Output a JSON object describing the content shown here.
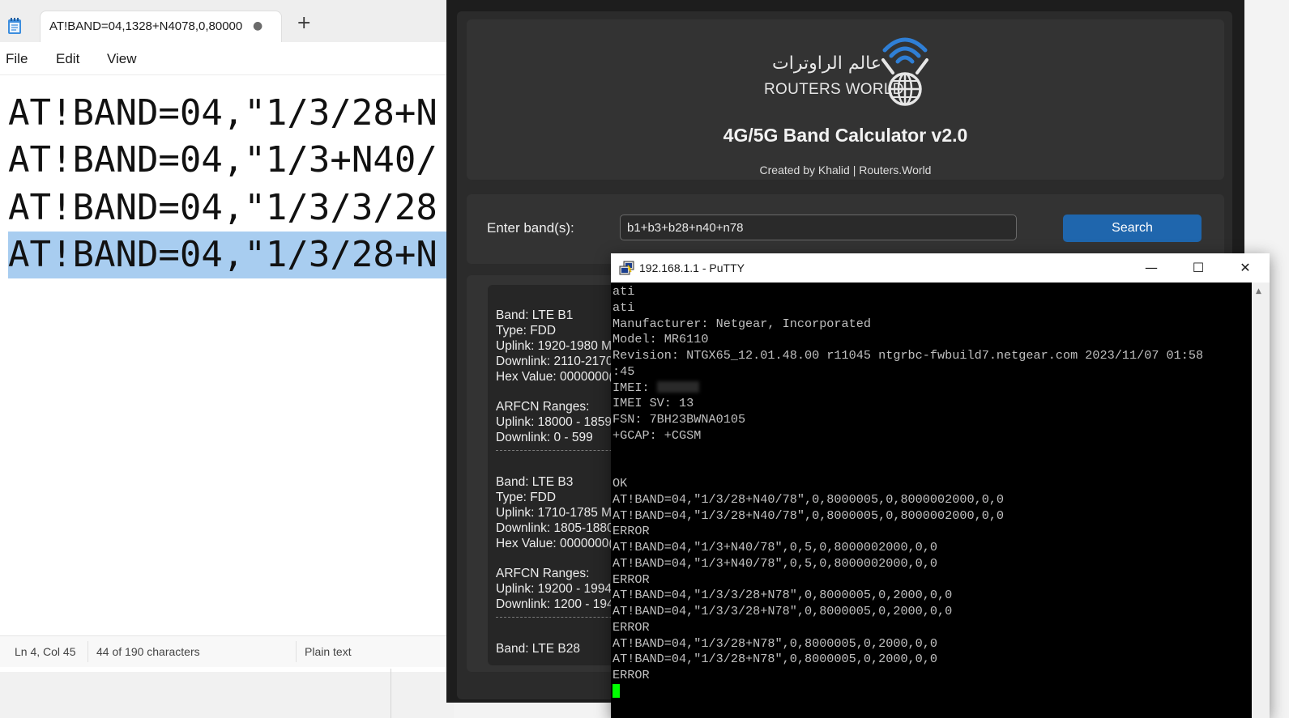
{
  "notepad": {
    "tab_title": "AT!BAND=04,1328+N4078,0,80000",
    "tab_unsaved": "●",
    "new_tab": "+",
    "menu": {
      "file": "File",
      "edit": "Edit",
      "view": "View"
    },
    "lines": [
      "AT!BAND=04,\"1/3/28+N",
      "AT!BAND=04,\"1/3+N40/",
      "AT!BAND=04,\"1/3/3/28",
      "AT!BAND=04,\"1/3/28+N"
    ],
    "status": {
      "position": "Ln 4, Col 45",
      "chars": "44 of 190 characters",
      "type": "Plain text"
    }
  },
  "calculator": {
    "logo_arabic": "عالم الراوترات",
    "logo_english": "ROUTERS WORLD",
    "title": "4G/5G Band Calculator v2.0",
    "credit": "Created by Khalid | Routers.World",
    "band_label": "Enter band(s):",
    "band_value": "b1+b3+b28+n40+n78",
    "search_label": "Search",
    "results": [
      {
        "band": "Band: LTE B1",
        "type": "Type: FDD",
        "uplink": "Uplink: 1920-1980 M",
        "downlink": "Downlink: 2110-2170",
        "hex": "Hex Value: 0000000(",
        "arfcn_title": "ARFCN Ranges:",
        "arfcn_up": "Uplink: 18000 - 1859",
        "arfcn_down": "Downlink: 0 - 599"
      },
      {
        "band": "Band: LTE B3",
        "type": "Type: FDD",
        "uplink": "Uplink: 1710-1785 M",
        "downlink": "Downlink: 1805-1880",
        "hex": "Hex Value: 0000000(",
        "arfcn_title": "ARFCN Ranges:",
        "arfcn_up": "Uplink: 19200 - 1994",
        "arfcn_down": "Downlink: 1200 - 194"
      }
    ],
    "next_band": "Band: LTE B28"
  },
  "putty": {
    "title": "192.168.1.1 - PuTTY",
    "minimize": "—",
    "maximize": "☐",
    "close": "✕",
    "lines": [
      "ati",
      "ati",
      "Manufacturer: Netgear, Incorporated",
      "Model: MR6110",
      "Revision: NTGX65_12.01.48.00 r11045 ntgrbc-fwbuild7.netgear.com 2023/11/07 01:58",
      ":45",
      "IMEI: ",
      "IMEI SV: 13",
      "FSN: 7BH23BWNA0105",
      "+GCAP: +CGSM",
      "",
      "",
      "OK",
      "AT!BAND=04,\"1/3/28+N40/78\",0,8000005,0,8000002000,0,0",
      "AT!BAND=04,\"1/3/28+N40/78\",0,8000005,0,8000002000,0,0",
      "ERROR",
      "AT!BAND=04,\"1/3+N40/78\",0,5,0,8000002000,0,0",
      "AT!BAND=04,\"1/3+N40/78\",0,5,0,8000002000,0,0",
      "ERROR",
      "AT!BAND=04,\"1/3/3/28+N78\",0,8000005,0,2000,0,0",
      "AT!BAND=04,\"1/3/3/28+N78\",0,8000005,0,2000,0,0",
      "ERROR",
      "AT!BAND=04,\"1/3/28+N78\",0,8000005,0,2000,0,0",
      "AT!BAND=04,\"1/3/28+N78\",0,8000005,0,2000,0,0",
      "ERROR"
    ],
    "colors": {
      "cursor": "#00ff00",
      "text": "#c0c0c0",
      "background": "#000000"
    }
  }
}
